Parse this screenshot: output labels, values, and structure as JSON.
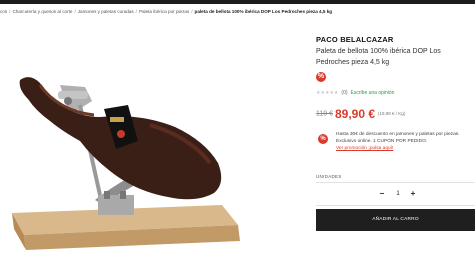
{
  "colors": {
    "accent": "#d83a2c",
    "dark": "#1f1f1f",
    "link_green": "#2e9a46"
  },
  "breadcrumb": {
    "items": [
      "cos",
      "Charcutería y quesos al corte",
      "Jamones y paletas curadas",
      "Paleta ibérica por piezas"
    ],
    "current": "paleta de bellota 100% ibérica DOP Los Pedroches pieza 4,5 kg",
    "separator": "/"
  },
  "product": {
    "brand": "PACO BELALCAZAR",
    "title": "Paleta de bellota 100% ibérica DOP Los Pedroches pieza 4,5 kg",
    "badge_symbol": "%",
    "badge_icon": "percent-icon",
    "rating": {
      "stars": "★★★★★",
      "count": "(0)",
      "review_link": "Escribe una opinión",
      "value": 0,
      "max": 5
    },
    "old_price": "119 €",
    "price": "89,90 €",
    "unit_price": "(19,98 € / Kg)",
    "image_alt": "Paleta ibérica en jamonero"
  },
  "promo": {
    "icon_symbol": "%",
    "icon": "percent-icon",
    "text": "Hasta 30€ de descuento en jamones y paletas por piezas. Exclusivo online. 1 CUPÓN POR PEDIDO.",
    "link": "Ver promoción ¡pulsa aquí!"
  },
  "purchase": {
    "units_label": "UNIDADES",
    "minus": "−",
    "quantity": "1",
    "plus": "+",
    "add_to_cart": "AÑADIR AL CARRO"
  }
}
